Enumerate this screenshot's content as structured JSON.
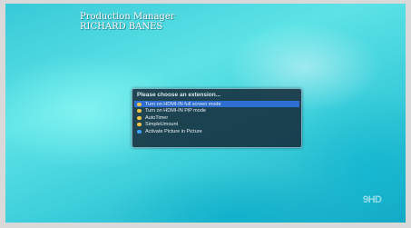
{
  "caption": {
    "line1": "Production Manager",
    "line2": "RICHARD BANES"
  },
  "menu": {
    "title": "Please choose an extension...",
    "selected_index": 0,
    "items": [
      {
        "label": "Turn on HDMI-IN full screen mode",
        "bullet_color": "#e9c34a"
      },
      {
        "label": "Turn on HDMI-IN PiP mode",
        "bullet_color": "#e9c34a"
      },
      {
        "label": "AutoTimer",
        "bullet_color": "#e9c34a"
      },
      {
        "label": "SimpleUmount",
        "bullet_color": "#e9c34a"
      },
      {
        "label": "Activate Picture in Picture",
        "bullet_color": "#3ea0ff"
      }
    ]
  },
  "channel_logo": "9HD"
}
